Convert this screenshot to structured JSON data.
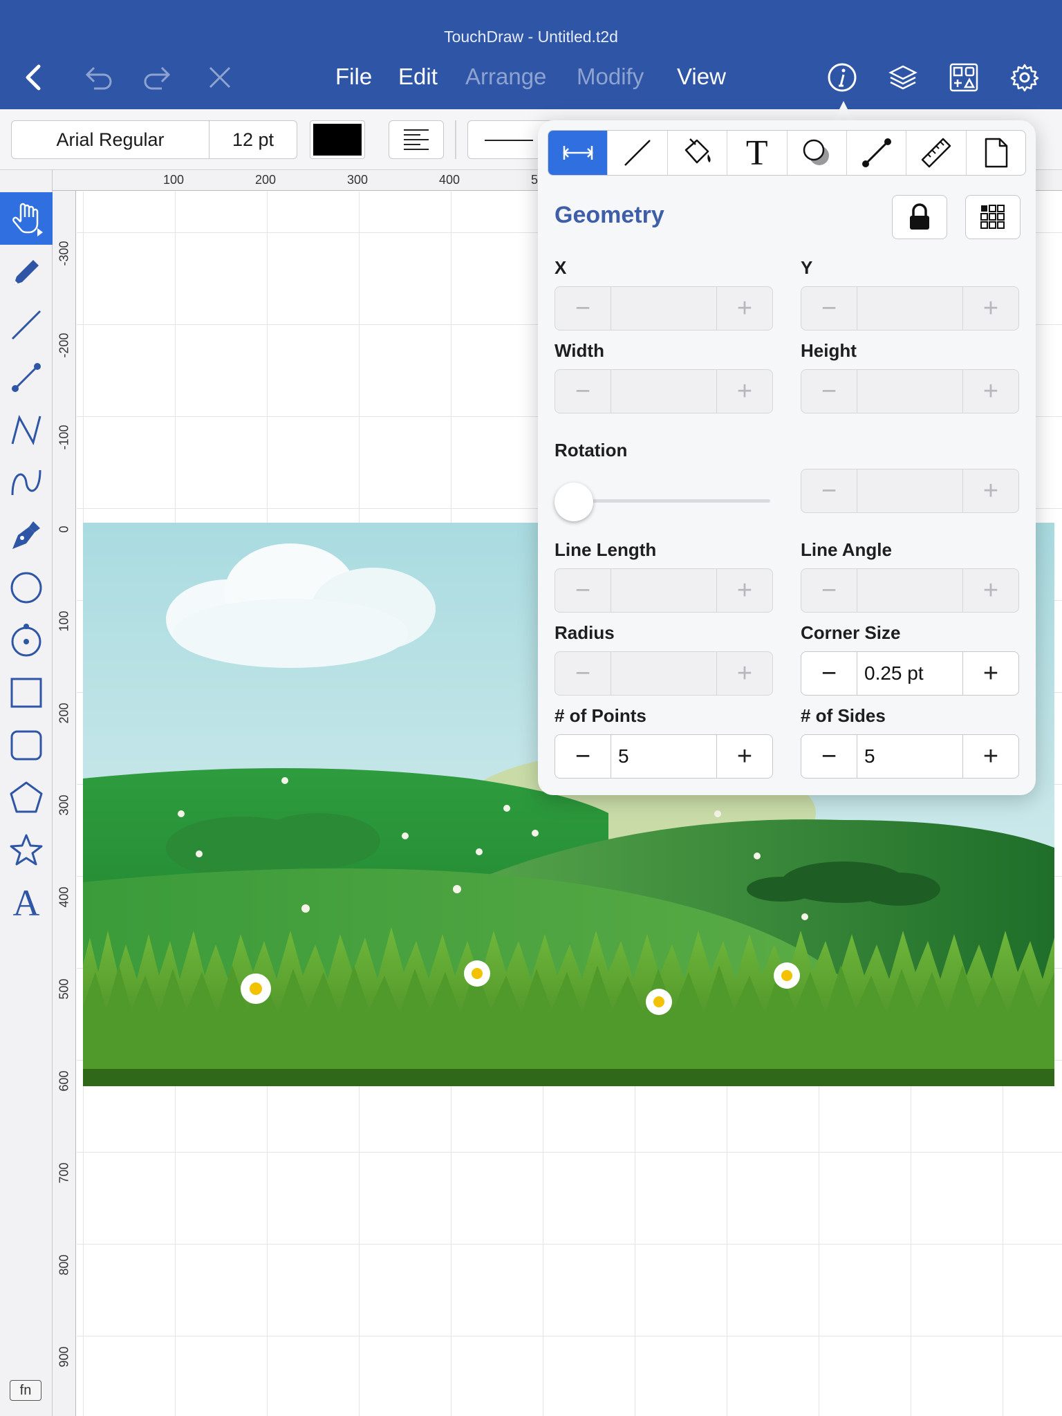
{
  "window": {
    "title": "TouchDraw - Untitled.t2d"
  },
  "menu": {
    "file": "File",
    "edit": "Edit",
    "arrange": "Arrange",
    "modify": "Modify",
    "view": "View"
  },
  "format": {
    "font_name": "Arial Regular",
    "font_size": "12 pt",
    "stroke_color": "#000000"
  },
  "ruler": {
    "horizontal": [
      "100",
      "200",
      "300",
      "400",
      "5"
    ],
    "vertical": [
      "-300",
      "-200",
      "-100",
      "0",
      "100",
      "200",
      "300",
      "400",
      "500",
      "600",
      "700",
      "800",
      "900"
    ]
  },
  "tools": [
    "select-hand",
    "pencil",
    "line",
    "connector",
    "polyline",
    "curve",
    "pen",
    "circle",
    "circle-center",
    "rectangle",
    "rounded-rectangle",
    "polygon",
    "star",
    "text"
  ],
  "tool_text_letter": "A",
  "fn_label": "fn",
  "inspector": {
    "tabs": [
      "geometry",
      "line",
      "fill",
      "text",
      "shadow",
      "connector",
      "measure",
      "page"
    ],
    "text_tab_letter": "T",
    "section_title": "Geometry",
    "fields": {
      "x": {
        "label": "X",
        "value": ""
      },
      "y": {
        "label": "Y",
        "value": ""
      },
      "width": {
        "label": "Width",
        "value": ""
      },
      "height": {
        "label": "Height",
        "value": ""
      },
      "rotation": {
        "label": "Rotation",
        "value": "",
        "slider_fraction": 0
      },
      "line_length": {
        "label": "Line Length",
        "value": ""
      },
      "line_angle": {
        "label": "Line Angle",
        "value": ""
      },
      "radius": {
        "label": "Radius",
        "value": ""
      },
      "corner_size": {
        "label": "Corner Size",
        "value": "0.25 pt"
      },
      "points": {
        "label": "# of Points",
        "value": "5"
      },
      "sides": {
        "label": "# of Sides",
        "value": "5"
      }
    },
    "minus": "−",
    "plus": "+"
  },
  "colors": {
    "nav": "#2f56a6",
    "accent": "#2f6fe0",
    "section": "#3f5ea8"
  }
}
